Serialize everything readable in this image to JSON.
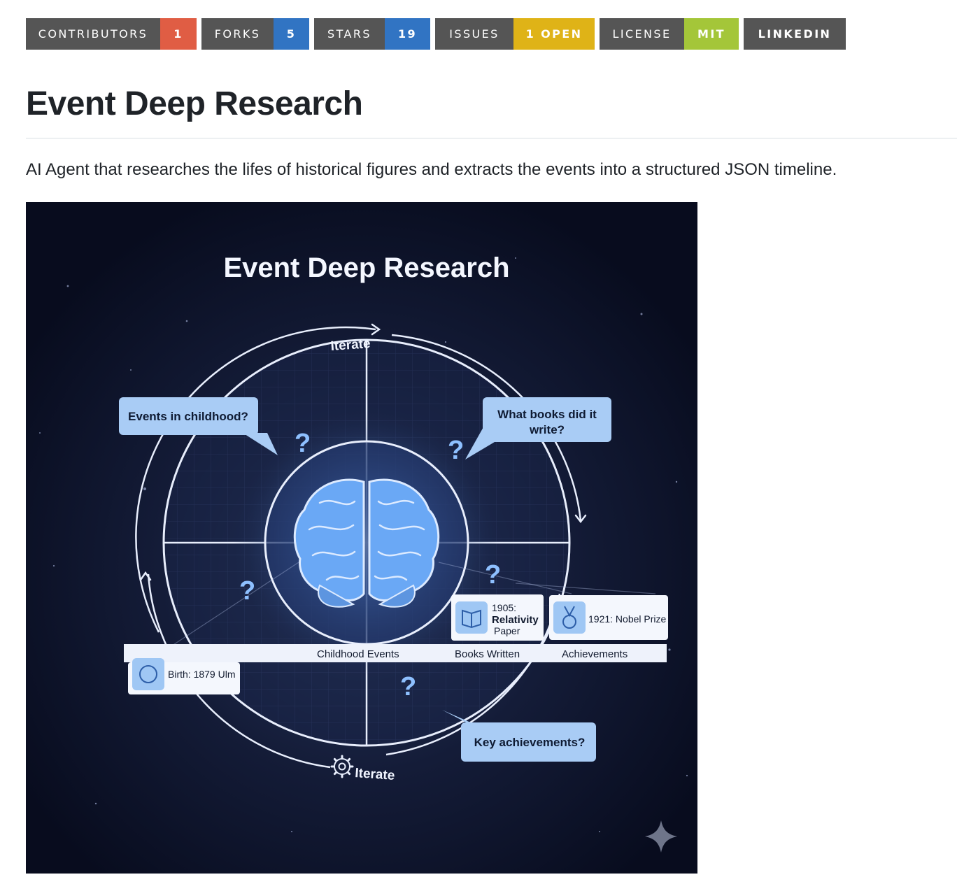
{
  "badges": [
    {
      "label": "CONTRIBUTORS",
      "value": "1",
      "color": "#e05d44"
    },
    {
      "label": "FORKS",
      "value": "5",
      "color": "#3174c3"
    },
    {
      "label": "STARS",
      "value": "19",
      "color": "#3174c3"
    },
    {
      "label": "ISSUES",
      "value": "1 OPEN",
      "color": "#dfb317"
    },
    {
      "label": "LICENSE",
      "value": "MIT",
      "color": "#a4c639"
    },
    {
      "label": "LINKEDIN"
    }
  ],
  "readme": {
    "title": "Event Deep Research",
    "description": "AI Agent that researches the lifes of historical figures and extracts the events into a structured JSON timeline."
  },
  "figure": {
    "title": "Event Deep Research",
    "iterate_top": "Iterate",
    "iterate_bottom": "Iterate",
    "bubbles": {
      "childhood": "Events in childhood?",
      "books_line1": "What books did it",
      "books_line2": "write?",
      "achievements": "Key achievements?"
    },
    "question_mark": "?",
    "timeline_labels": {
      "childhood": "Childhood Events",
      "books": "Books Written",
      "achievements": "Achievements"
    },
    "cards": {
      "birth": "Birth: 1879 Ulm",
      "relativity_year": "1905:",
      "relativity_title": "Relativity",
      "relativity_sub": "Paper",
      "nobel": "1921: Nobel Prize"
    }
  }
}
